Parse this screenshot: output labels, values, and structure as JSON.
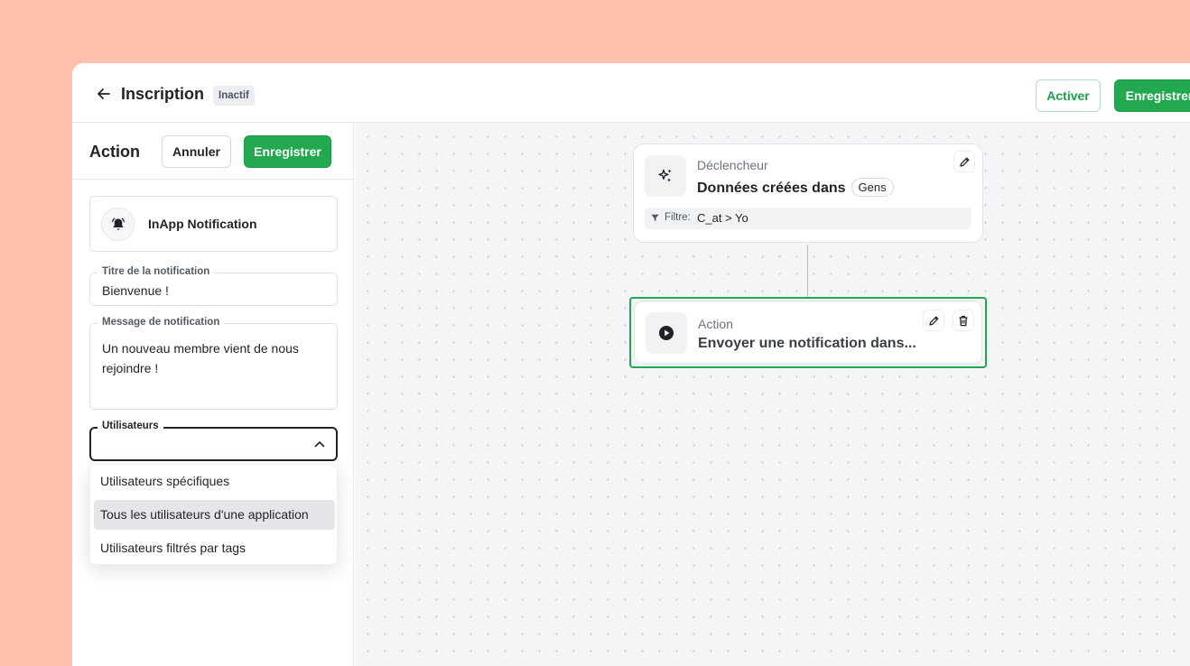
{
  "header": {
    "back_icon": "arrow-left-icon",
    "title": "Inscription",
    "status_badge": "Inactif",
    "activate_label": "Activer",
    "save_label": "Enregistrer"
  },
  "panel": {
    "title": "Action",
    "cancel_label": "Annuler",
    "save_label": "Enregistrer",
    "action_card": {
      "icon": "bell-icon",
      "label": "InApp Notification"
    },
    "notification_title": {
      "label": "Titre de la notification",
      "value": "Bienvenue !"
    },
    "notification_message": {
      "label": "Message de notification",
      "value": "Un nouveau membre vient de nous rejoindre !"
    },
    "users": {
      "label": "Utilisateurs",
      "value": "",
      "options": [
        "Utilisateurs spécifiques",
        "Tous les utilisateurs d'une application",
        "Utilisateurs filtrés par tags"
      ],
      "highlighted_index": 1
    }
  },
  "canvas": {
    "trigger": {
      "kind": "Déclencheur",
      "title": "Données créées dans",
      "tag": "Gens",
      "icon": "sparkles-icon",
      "filter_label": "Filtre:",
      "filter_value": "C_at > Yo"
    },
    "action": {
      "kind": "Action",
      "title": "Envoyer une notification dans...",
      "icon": "play-circle-icon"
    }
  },
  "colors": {
    "background": "#FFBFAB",
    "accent_green": "#22A94F",
    "canvas_bg": "#F4F5F7"
  }
}
